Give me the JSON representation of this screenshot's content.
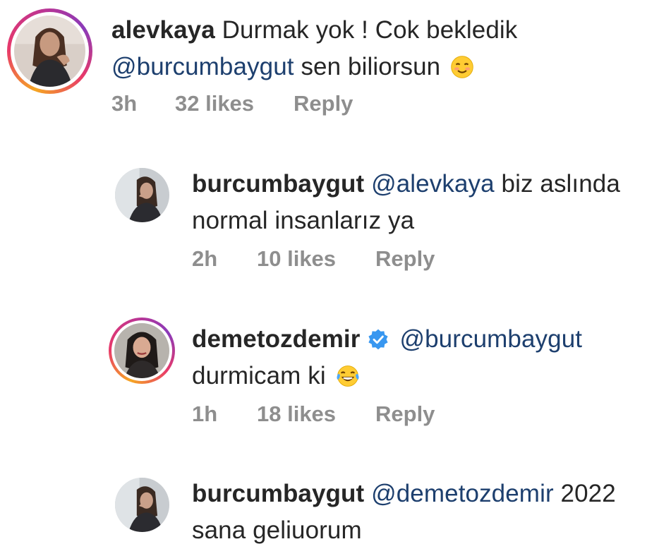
{
  "comments": [
    {
      "username": "alevkaya",
      "text_before": "Durmak yok ! Cok bekledik",
      "mention": "@burcumbaygut",
      "text_after": "sen biliorsun",
      "emoji": "smiling-face-with-smiling-eyes",
      "time": "3h",
      "likes": "32 likes",
      "reply": "Reply",
      "avatar_ring": true
    },
    {
      "username": "burcumbaygut",
      "mention": "@alevkaya",
      "text_after": "biz aslında",
      "text_line2": "normal insanlarız ya",
      "time": "2h",
      "likes": "10 likes",
      "reply": "Reply",
      "avatar_ring": false
    },
    {
      "username": "demetozdemir",
      "verified": true,
      "mention": "@burcumbaygut",
      "text_line2": "durmicam ki",
      "emoji": "face-with-tears-of-joy",
      "time": "1h",
      "likes": "18 likes",
      "reply": "Reply",
      "avatar_ring": true
    },
    {
      "username": "burcumbaygut",
      "mention": "@demetozdemir",
      "text_after": "2022",
      "text_line2": "sana geliuorum",
      "avatar_ring": false
    }
  ],
  "colors": {
    "text": "#262626",
    "mention": "#1d3f6e",
    "meta": "#8e8e8e",
    "verified": "#3897f0"
  }
}
